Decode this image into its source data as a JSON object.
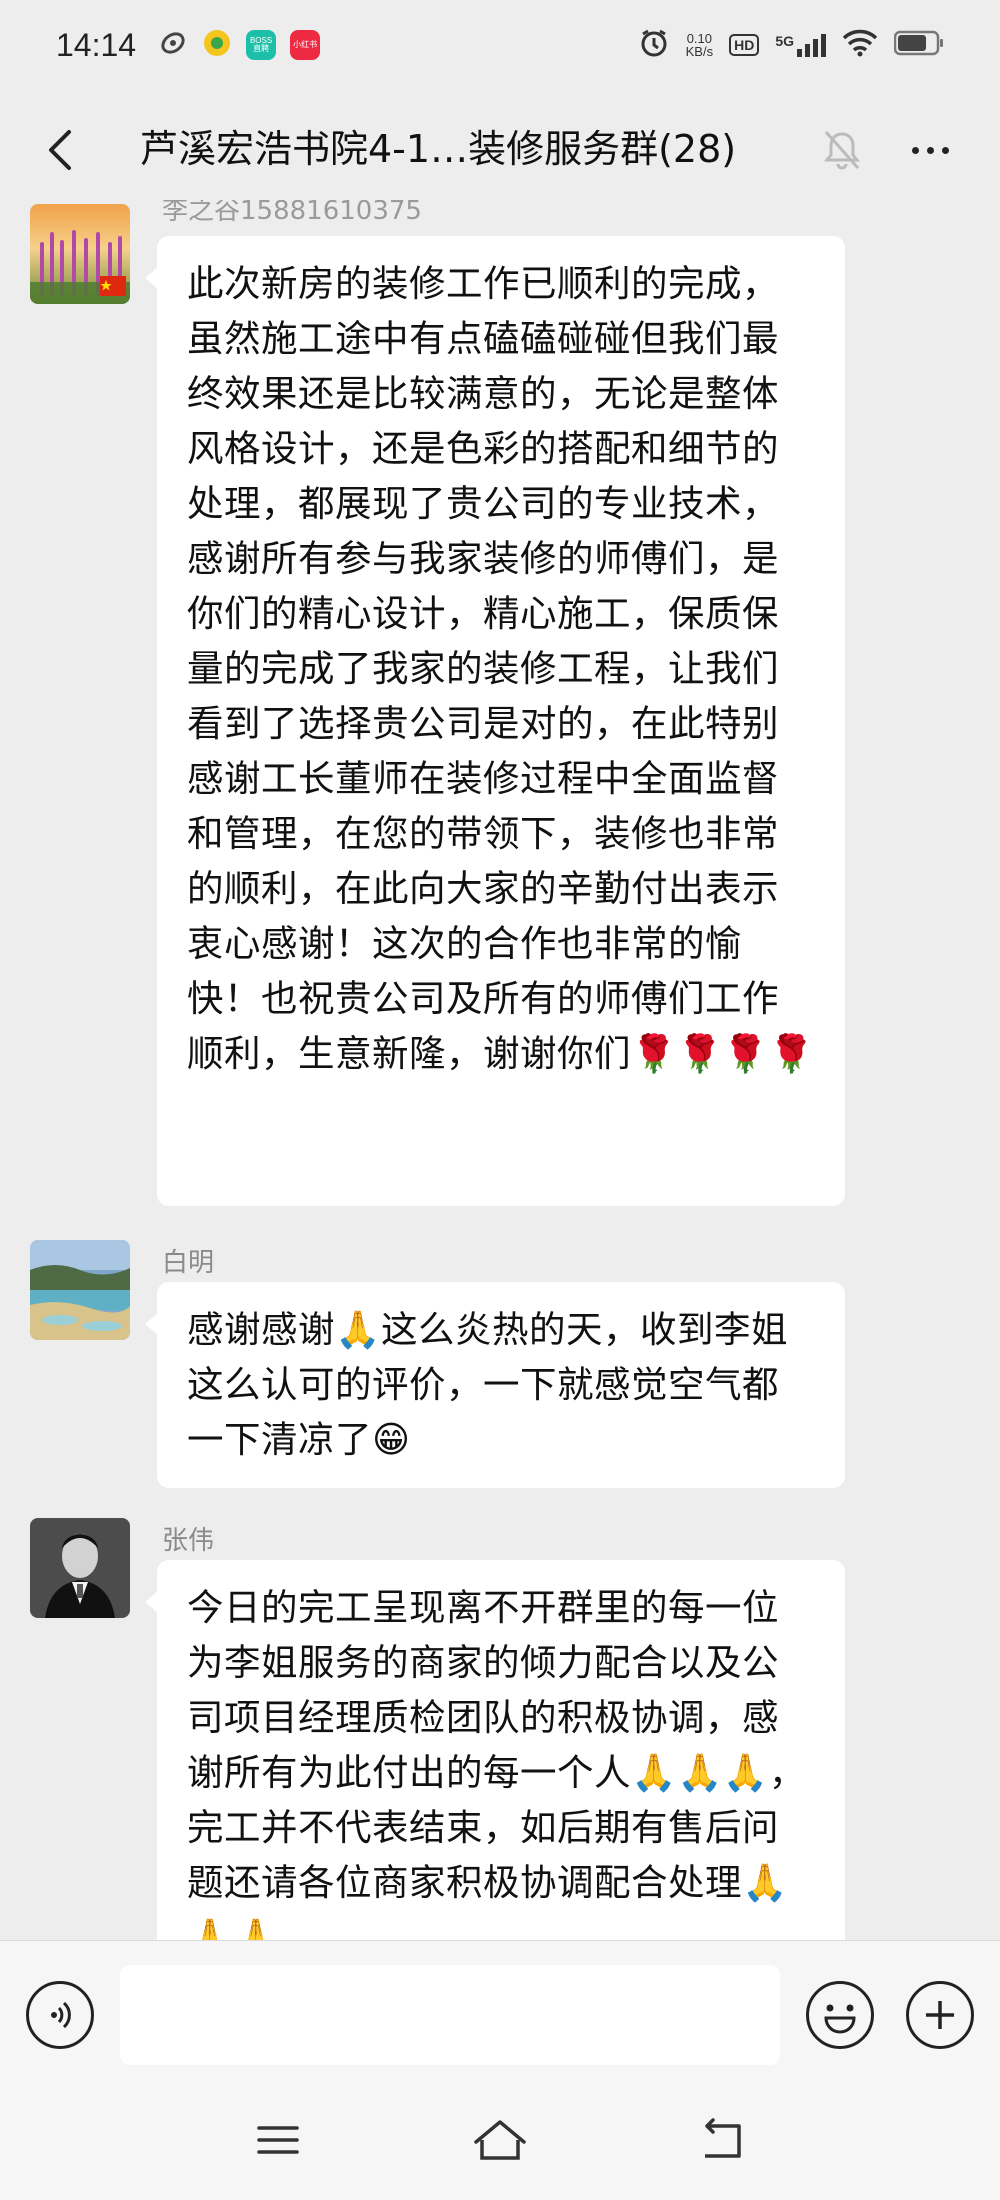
{
  "status_bar": {
    "time": "14:14",
    "app_badges": [
      {
        "name": "boss-zhipin",
        "text": "BOSS\n直聘",
        "color": "#1dbfa8"
      },
      {
        "name": "xiaohongshu",
        "text": "小红书",
        "color": "#ee2a43"
      }
    ],
    "net_speed_value": "0.10",
    "net_speed_unit": "KB/s",
    "hd": "HD",
    "network": "5G"
  },
  "header": {
    "title": "芦溪宏浩书院4-1…装修服务群(28)"
  },
  "messages": [
    {
      "sender": "李之谷15881610375",
      "avatar": "flower-field",
      "text": "此次新房的装修工作已顺利的完成，虽然施工途中有点磕磕碰碰但我们最终效果还是比较满意的，无论是整体风格设计，还是色彩的搭配和细节的处理，都展现了贵公司的专业技术，感谢所有参与我家装修的师傅们，是你们的精心设计，精心施工，保质保量的完成了我家的装修工程，让我们看到了选择贵公司是对的，在此特别感谢工长董师在装修过程中全面监督和管理，在您的带领下，装修也非常的顺利，在此向大家的辛勤付出表示衷心感谢！这次的合作也非常的愉快！也祝贵公司及所有的师傅们工作顺利，生意新隆，谢谢你们🌹🌹🌹🌹"
    },
    {
      "sender": "白明",
      "avatar": "lake-landscape",
      "text": "感谢感谢🙏这么炎热的天，收到李姐这么认可的评价，一下就感觉空气都一下清凉了😁"
    },
    {
      "sender": "张伟",
      "avatar": "man-portrait",
      "text": "今日的完工呈现离不开群里的每一位为李姐服务的商家的倾力配合以及公司项目经理质检团队的积极协调，感谢所有为此付出的每一个人🙏🙏🙏，完工并不代表结束，如后期有售后问题还请各位商家积极协调配合处理🙏🙏🙏"
    }
  ],
  "input": {
    "placeholder": ""
  }
}
